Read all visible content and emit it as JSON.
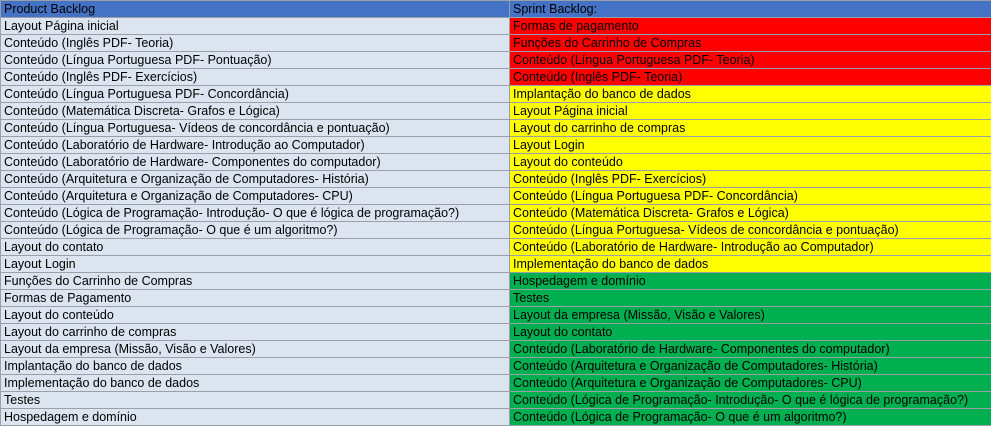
{
  "headers": {
    "product": "Product Backlog",
    "sprint": "Sprint Backlog:"
  },
  "colors": {
    "header": "#4472c4",
    "product_row": "#dce4f0",
    "red": "#ff0000",
    "yellow": "#ffff00",
    "green": "#00b050"
  },
  "rows": [
    {
      "product": "Layout Página inicial",
      "sprint": "Formas de pagamento",
      "status": "red"
    },
    {
      "product": "Conteúdo (Inglês PDF- Teoria)",
      "sprint": "Funções do Carrinho de Compras",
      "status": "red"
    },
    {
      "product": "Conteúdo (Língua Portuguesa PDF- Pontuação)",
      "sprint": "Conteúdo (Língua Portuguesa PDF- Teoria)",
      "status": "red"
    },
    {
      "product": "Conteúdo (Inglês PDF- Exercícios)",
      "sprint": "Conteúdo (Inglês PDF- Teoria)",
      "status": "red"
    },
    {
      "product": "Conteúdo (Língua Portuguesa PDF- Concordância)",
      "sprint": "Implantação do banco de dados",
      "status": "yellow"
    },
    {
      "product": "Conteúdo (Matemática Discreta- Grafos e Lógica)",
      "sprint": "Layout Página inicial",
      "status": "yellow"
    },
    {
      "product": "Conteúdo (Língua Portuguesa- Vídeos de concordância e pontuação)",
      "sprint": "Layout do carrinho de compras",
      "status": "yellow"
    },
    {
      "product": "Conteúdo (Laboratório de Hardware- Introdução ao Computador)",
      "sprint": "Layout Login",
      "status": "yellow"
    },
    {
      "product": "Conteúdo (Laboratório de Hardware- Componentes do computador)",
      "sprint": "Layout do conteúdo",
      "status": "yellow"
    },
    {
      "product": "Conteúdo (Arquitetura e Organização de Computadores- História)",
      "sprint": "Conteúdo (Inglês PDF- Exercícios)",
      "status": "yellow"
    },
    {
      "product": "Conteúdo (Arquitetura e Organização de Computadores- CPU)",
      "sprint": "Conteúdo (Língua Portuguesa PDF- Concordância)",
      "status": "yellow"
    },
    {
      "product": "Conteúdo (Lógica de Programação- Introdução- O que é lógica de programação?)",
      "sprint": "Conteúdo (Matemática Discreta- Grafos e Lógica)",
      "status": "yellow"
    },
    {
      "product": "Conteúdo (Lógica de Programação- O que é um algoritmo?)",
      "sprint": "Conteúdo (Língua Portuguesa- Vídeos de concordância e pontuação)",
      "status": "yellow"
    },
    {
      "product": "Layout do contato",
      "sprint": "Conteúdo (Laboratório de Hardware- Introdução ao Computador)",
      "status": "yellow"
    },
    {
      "product": "Layout Login",
      "sprint": "Implementação do banco de dados",
      "status": "yellow"
    },
    {
      "product": "Funções do Carrinho de Compras",
      "sprint": "Hospedagem e domínio",
      "status": "green"
    },
    {
      "product": "Formas de Pagamento",
      "sprint": "Testes",
      "status": "green"
    },
    {
      "product": "Layout do conteúdo",
      "sprint": "Layout da empresa (Missão, Visão e Valores)",
      "status": "green"
    },
    {
      "product": "Layout do carrinho de compras",
      "sprint": "Layout do contato",
      "status": "green"
    },
    {
      "product": "Layout da empresa (Missão, Visão e Valores)",
      "sprint": "Conteúdo (Laboratório de Hardware- Componentes do computador)",
      "status": "green"
    },
    {
      "product": "Implantação do banco de dados",
      "sprint": "Conteúdo (Arquitetura e Organização de Computadores- História)",
      "status": "green"
    },
    {
      "product": "Implementação do banco de dados",
      "sprint": "Conteúdo (Arquitetura e Organização de Computadores- CPU)",
      "status": "green"
    },
    {
      "product": "Testes",
      "sprint": "Conteúdo (Lógica de Programação- Introdução- O que é lógica de programação?)",
      "status": "green"
    },
    {
      "product": "Hospedagem e domínio",
      "sprint": "Conteúdo (Lógica de Programação- O que é um algoritmo?)",
      "status": "green"
    }
  ]
}
